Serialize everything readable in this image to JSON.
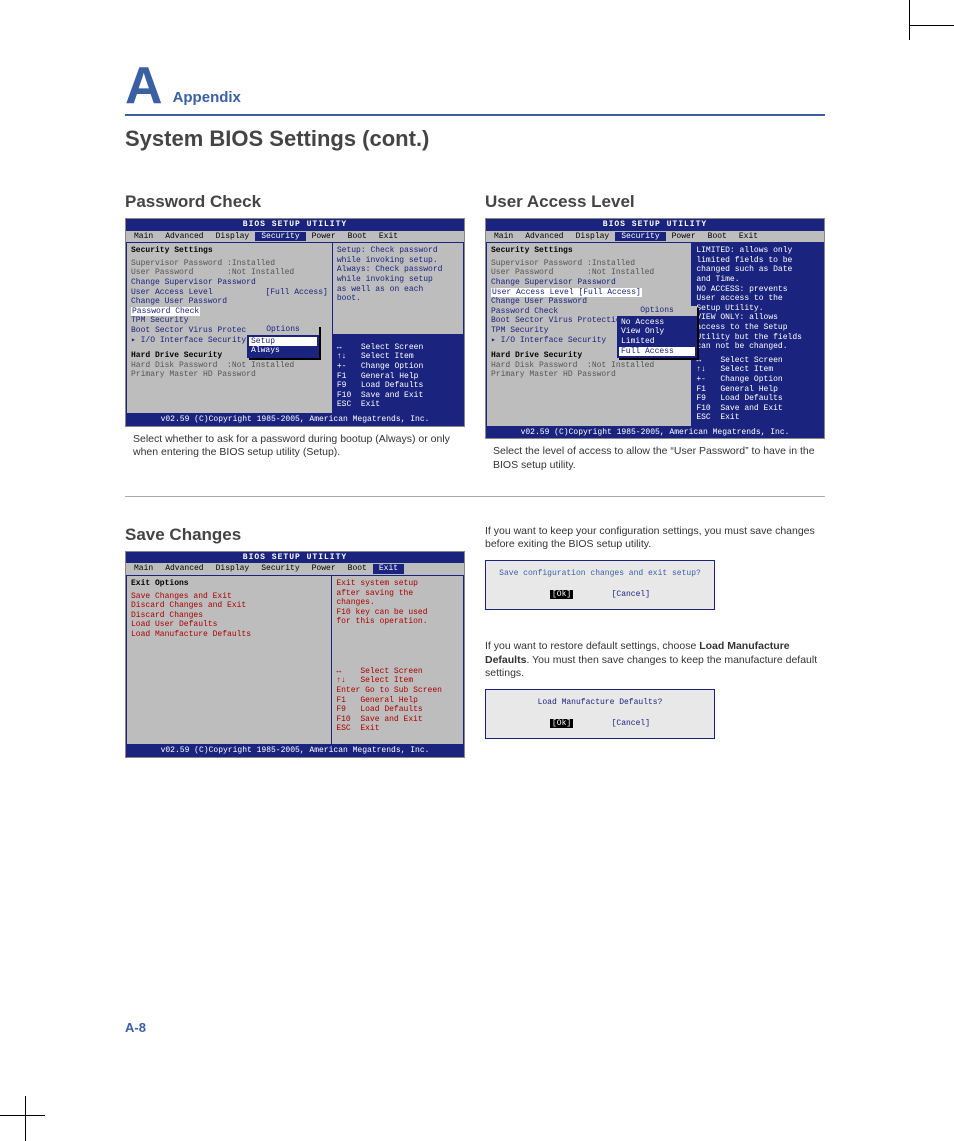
{
  "appendix": {
    "letter": "A",
    "word": "Appendix"
  },
  "section_title": "System BIOS Settings (cont.)",
  "password_check": {
    "heading": "Password Check",
    "caption": "Select whether to ask for a password during bootup (Always) or only when entering the BIOS setup utility (Setup).",
    "bios": {
      "title": "BIOS SETUP UTILITY",
      "menu": [
        "Main",
        "Advanced",
        "Display",
        "Security",
        "Power",
        "Boot",
        "Exit"
      ],
      "menu_sel": "Security",
      "left_head": "Security Settings",
      "lines": [
        "Supervisor Password :Installed",
        "User Password       :Not Installed",
        "",
        "Change Supervisor Password",
        "User Access Level           [Full Access]",
        "Change User Password"
      ],
      "hl_line": "Password Check",
      "after": [
        "TPM Security",
        "",
        "Boot Sector Virus Protection",
        "",
        "▸ I/O Interface Security"
      ],
      "black1": "Hard Drive Security",
      "grey": [
        "Hard Disk Password  :Not Installed",
        "Primary Master HD Password"
      ],
      "popup_head": "Options",
      "popup_items": [
        "Setup",
        "Always"
      ],
      "popup_sel": "Setup",
      "help": [
        "Setup: Check password",
        "while invoking setup.",
        "Always: Check password",
        "while invoking setup",
        "as well as on each",
        "boot."
      ],
      "nav": [
        "↔    Select Screen",
        "↑↓   Select Item",
        "+-   Change Option",
        "F1   General Help",
        "F9   Load Defaults",
        "F10  Save and Exit",
        "ESC  Exit"
      ],
      "foot": "v02.59 (C)Copyright 1985-2005, American Megatrends, Inc."
    }
  },
  "user_access": {
    "heading": "User Access Level",
    "caption": "Select the level of access to allow the “User Password” to have in the BIOS setup utility.",
    "bios": {
      "title": "BIOS SETUP UTILITY",
      "menu": [
        "Main",
        "Advanced",
        "Display",
        "Security",
        "Power",
        "Boot",
        "Exit"
      ],
      "menu_sel": "Security",
      "left_head": "Security Settings",
      "lines": [
        "Supervisor Password :Installed",
        "User Password       :Not Installed",
        "",
        "Change Supervisor Password"
      ],
      "hl_line": "User Access Level           [Full Access]",
      "after": [
        "Change User Password",
        "Password Check",
        "",
        "Boot Sector Virus Protection",
        "TPM Security",
        "",
        "▸ I/O Interface Security"
      ],
      "black1": "Hard Drive Security",
      "grey": [
        "Hard Disk Password  :Not Installed",
        "Primary Master HD Password"
      ],
      "popup_head": "Options",
      "popup_items": [
        "No Access",
        "View Only",
        "Limited",
        "Full Access"
      ],
      "popup_sel": "Full Access",
      "help": [
        "LIMITED: allows only",
        "limited fields to be",
        "changed such as Date",
        "and Time.",
        "NO ACCESS: prevents",
        "User access to the",
        "Setup Utility.",
        "VIEW ONLY: allows",
        "access to the Setup",
        "Utility but the fields",
        "can not be changed."
      ],
      "nav": [
        "↔    Select Screen",
        "↑↓   Select Item",
        "+-   Change Option",
        "F1   General Help",
        "F9   Load Defaults",
        "F10  Save and Exit",
        "ESC  Exit"
      ],
      "foot": "v02.59 (C)Copyright 1985-2005, American Megatrends, Inc."
    }
  },
  "save_changes": {
    "heading": "Save Changes",
    "para1": "If you want to keep your configuration settings, you must save changes before exiting the BIOS setup utility.",
    "para2a": "If you want to restore default settings, choose ",
    "para2b": "Load Manufacture Defaults",
    "para2c": ". You must then save changes to keep the manufacture default settings.",
    "dlg1": {
      "text": "Save configuration changes and exit setup?",
      "ok": "[Ok]",
      "cancel": "[Cancel]"
    },
    "dlg2": {
      "text": "Load Manufacture Defaults?",
      "ok": "[Ok]",
      "cancel": "[Cancel]"
    },
    "bios": {
      "title": "BIOS SETUP UTILITY",
      "menu": [
        "Main",
        "Advanced",
        "Display",
        "Security",
        "Power",
        "Boot",
        "Exit"
      ],
      "menu_sel": "Exit",
      "left_head": "Exit Options",
      "lines": [
        "Save Changes and Exit",
        "Discard Changes and Exit",
        "Discard Changes",
        "",
        "Load User Defaults",
        "Load Manufacture Defaults"
      ],
      "hl_line": "Save Changes and Exit",
      "help": [
        "Exit system setup",
        "after saving the",
        "changes.",
        "",
        "F10 key can be used",
        "for this operation."
      ],
      "nav": [
        "↔    Select Screen",
        "↑↓   Select Item",
        "Enter Go to Sub Screen",
        "F1   General Help",
        "F9   Load Defaults",
        "F10  Save and Exit",
        "ESC  Exit"
      ],
      "foot": "v02.59 (C)Copyright 1985-2005, American Megatrends, Inc."
    }
  },
  "page_num": "A-8"
}
